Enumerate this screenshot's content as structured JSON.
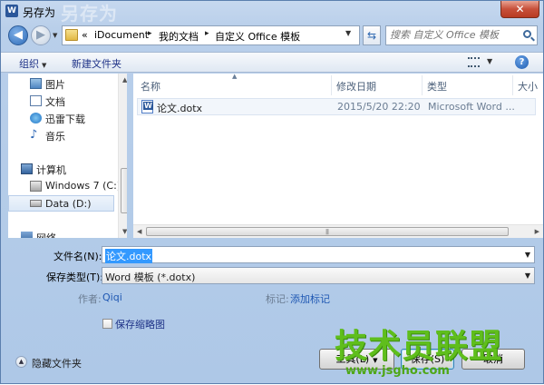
{
  "window": {
    "title": "另存为",
    "title_ghost": "另存为",
    "close_glyph": "✕",
    "app_icon": "W"
  },
  "address": {
    "segments": [
      "iDocument",
      "我的文档",
      "自定义 Office 模板"
    ],
    "prefix": "«",
    "separator": "▸"
  },
  "search": {
    "placeholder": "搜索 自定义 Office 模板"
  },
  "toolbar": {
    "organize_label": "组织",
    "new_folder_label": "新建文件夹",
    "help_glyph": "?"
  },
  "sidebar": {
    "items": [
      {
        "label": "图片",
        "icon": "pictures-icon"
      },
      {
        "label": "文档",
        "icon": "documents-icon"
      },
      {
        "label": "迅雷下载",
        "icon": "download-icon"
      },
      {
        "label": "音乐",
        "icon": "music-icon"
      },
      {
        "label": "计算机",
        "icon": "computer-icon"
      },
      {
        "label": "Windows 7 (C:)",
        "icon": "drive-icon"
      },
      {
        "label": "Data (D:)",
        "icon": "drive-icon"
      },
      {
        "label": "网络",
        "icon": "network-icon"
      }
    ]
  },
  "file_list": {
    "columns": [
      "名称",
      "修改日期",
      "类型",
      "大小"
    ],
    "rows": [
      {
        "name": "论文.dotx",
        "modified": "2015/5/20 22:20",
        "type": "Microsoft Word ..."
      }
    ]
  },
  "form": {
    "filename_label": "文件名(N):",
    "filename_value": "论文.dotx",
    "filetype_label": "保存类型(T):",
    "filetype_value": "Word 模板 (*.dotx)",
    "author_label": "作者:",
    "author_value": "Qiqi",
    "tags_label": "标记:",
    "tags_value": "添加标记",
    "thumbnail_label": "保存缩略图"
  },
  "footer": {
    "hide_folders_label": "隐藏文件夹",
    "tools_label": "工具(L)",
    "save_label": "保存(S)",
    "cancel_label": "取消"
  },
  "watermark": {
    "main": "技术员联盟",
    "url": "www.jsgho.com"
  },
  "colors": {
    "accent": "#3399ff",
    "link": "#1f58b3",
    "watermark_green": "#5fbe1c"
  }
}
